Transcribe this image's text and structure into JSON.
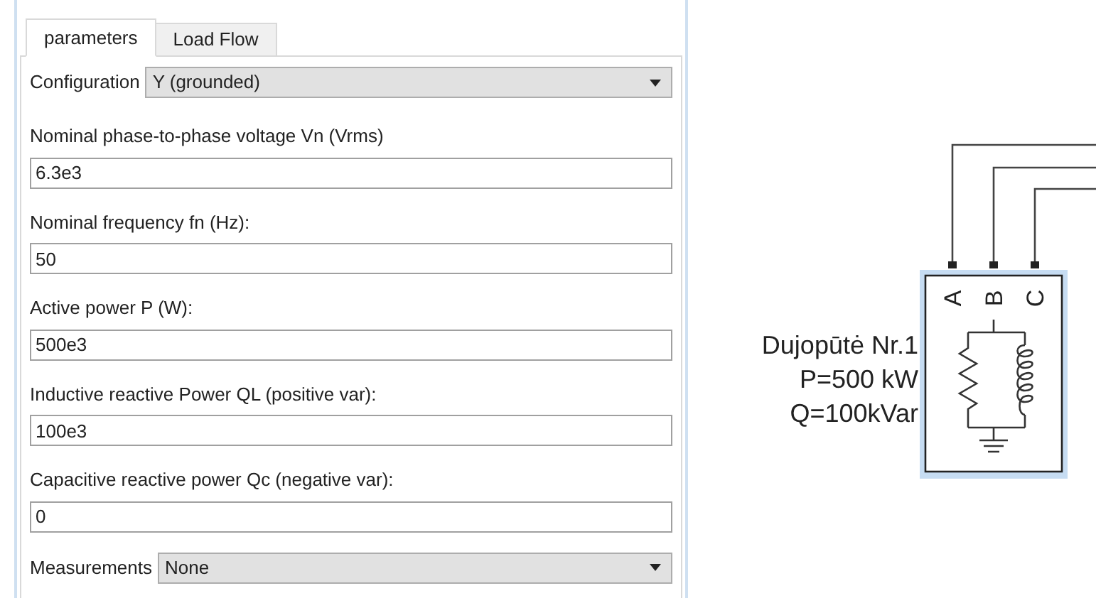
{
  "tabs": [
    {
      "label": "parameters",
      "selected": true
    },
    {
      "label": "Load Flow",
      "selected": false
    }
  ],
  "fields": [
    {
      "kind": "dropdown",
      "label": "Configuration",
      "value": "Y (grounded)"
    },
    {
      "kind": "text",
      "label": "Nominal phase-to-phase voltage Vn (Vrms)",
      "value": "6.3e3"
    },
    {
      "kind": "text",
      "label": "Nominal frequency fn (Hz):",
      "value": "50"
    },
    {
      "kind": "text",
      "label": "Active power P (W):",
      "value": "500e3"
    },
    {
      "kind": "text",
      "label": "Inductive reactive Power QL (positive var):",
      "value": "100e3"
    },
    {
      "kind": "text",
      "label": "Capacitive reactive power Qc (negative var):",
      "value": "0"
    },
    {
      "kind": "dropdown",
      "label": "Measurements",
      "value": "None"
    }
  ],
  "block": {
    "selected": true,
    "ports": [
      "A",
      "B",
      "C"
    ],
    "labels": [
      "Dujopūtė Nr.1",
      "P=500 kW",
      "Q=100kVar"
    ]
  }
}
